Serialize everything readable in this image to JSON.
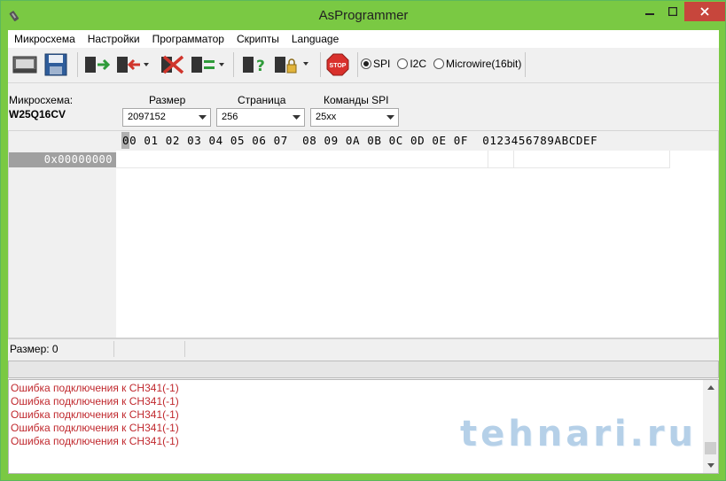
{
  "window": {
    "title": "AsProgrammer"
  },
  "menu": [
    "Микросхема",
    "Настройки",
    "Программатор",
    "Скрипты",
    "Language"
  ],
  "toolbar": {
    "buttons": [
      "open-icon",
      "save-icon",
      "read-icon",
      "write-icon",
      "erase-icon",
      "verify-icon",
      "chip-info-icon",
      "chip-lock-icon",
      "stop-icon"
    ],
    "stop_label": "STOP",
    "protocols": [
      {
        "label": "SPI",
        "selected": true
      },
      {
        "label": "I2C",
        "selected": false
      },
      {
        "label": "Microwire(16bit)",
        "selected": false
      }
    ]
  },
  "chip": {
    "label": "Микросхема:",
    "name": "W25Q16CV",
    "size_label": "Размер",
    "size_value": "2097152",
    "page_label": "Страница",
    "page_value": "256",
    "spi_label": "Команды SPI",
    "spi_value": "25xx"
  },
  "hex": {
    "header": "00 01 02 03 04 05 06 07  08 09 0A 0B 0C 0D 0E 0F  0123456789ABCDEF",
    "rows": [
      "0x00000000"
    ]
  },
  "status": {
    "size_text": "Размер: 0"
  },
  "log": [
    "Ошибка подключения к CH341(-1)",
    "Ошибка подключения к CH341(-1)",
    "Ошибка подключения к CH341(-1)",
    "Ошибка подключения к CH341(-1)",
    "Ошибка подключения к CH341(-1)"
  ],
  "watermark": "tehnari.ru",
  "colors": {
    "titlebar": "#7ac943",
    "close": "#c7463c",
    "error_text": "#c0282d",
    "stop": "#d9302c"
  }
}
